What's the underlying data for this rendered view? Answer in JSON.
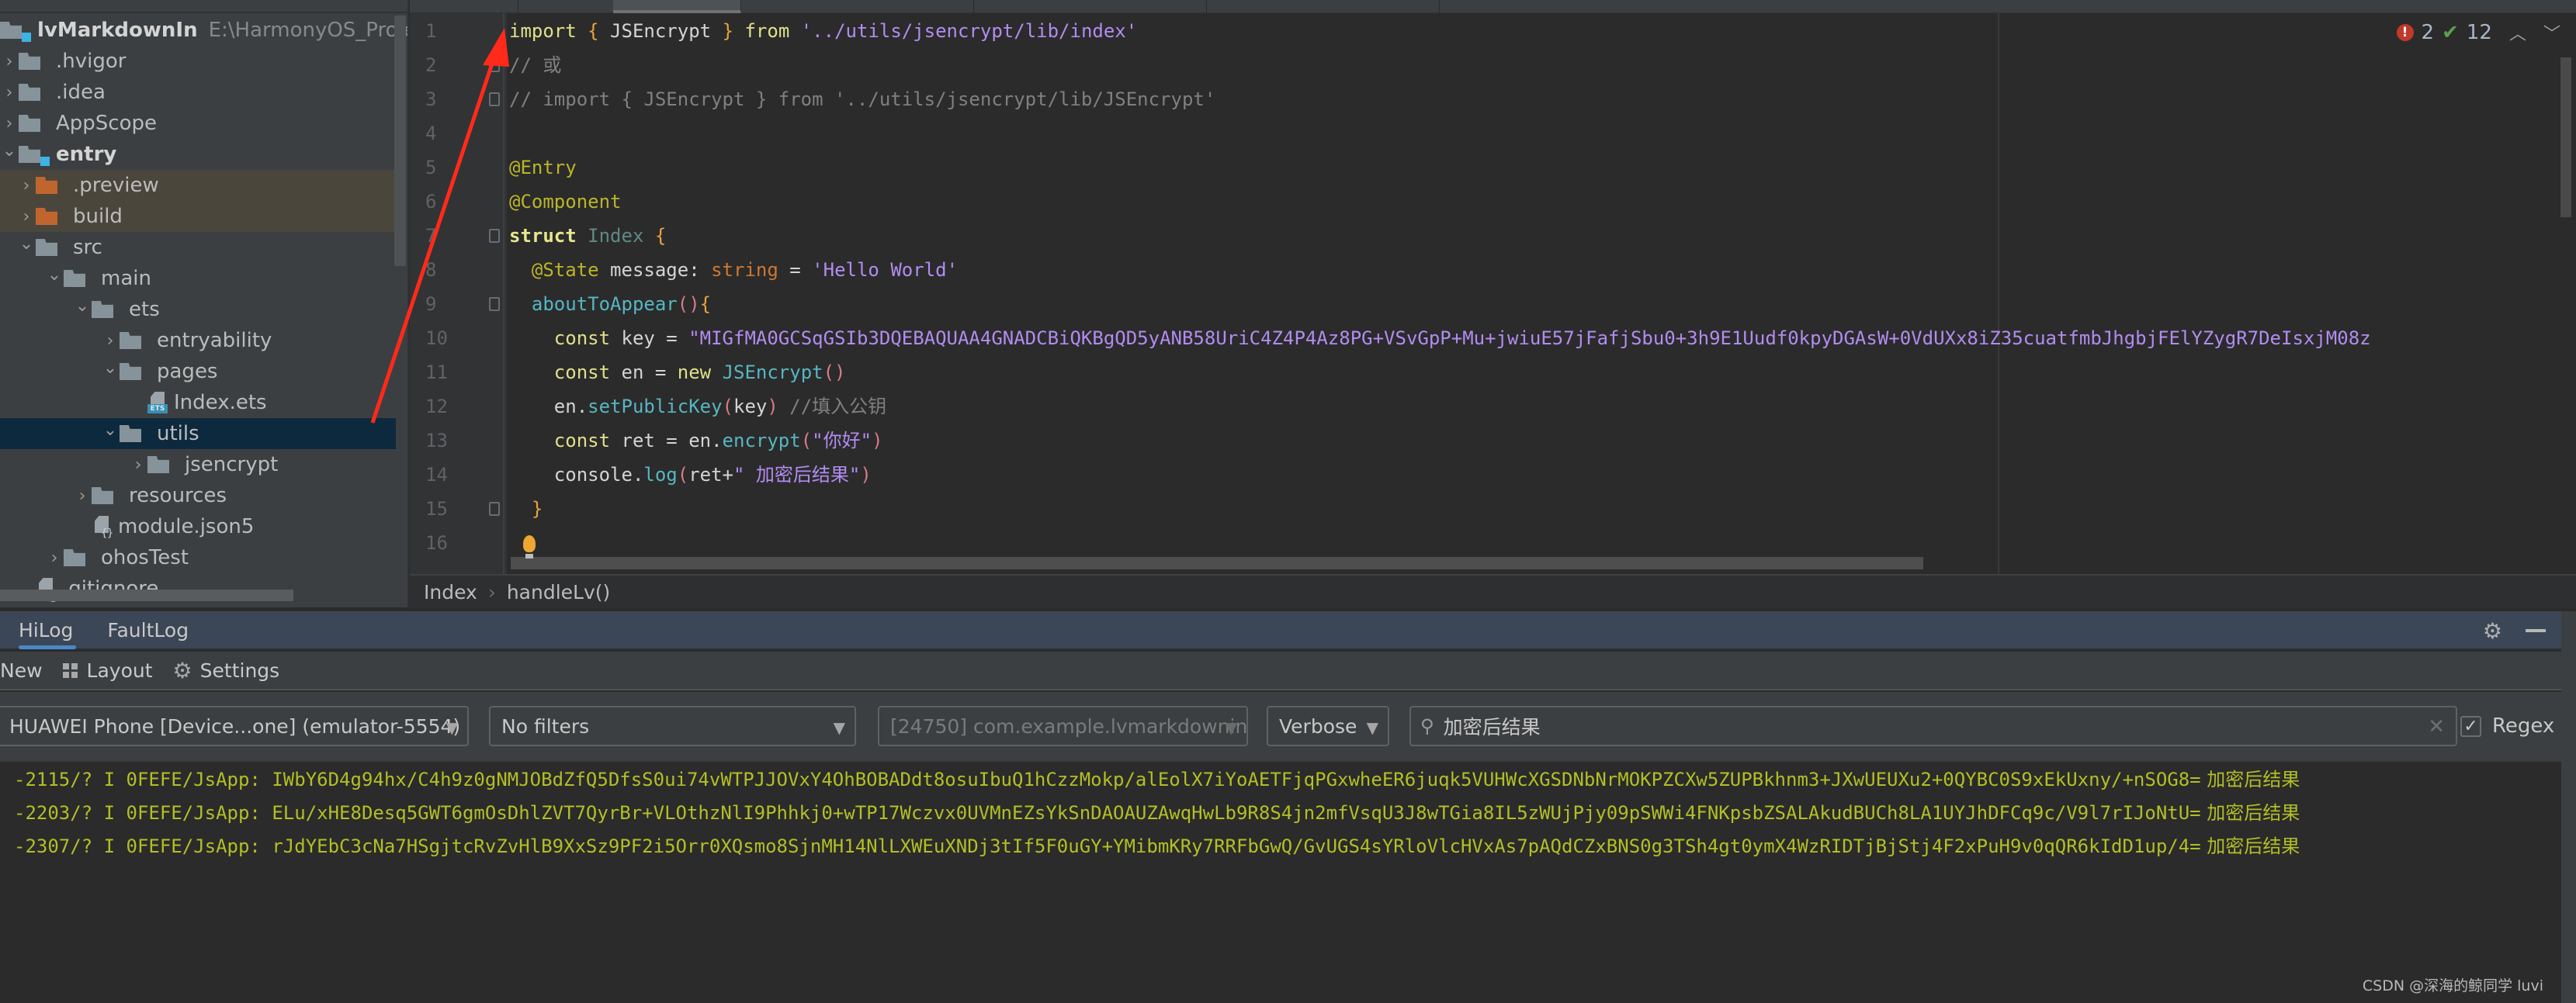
{
  "project": {
    "root_name": "lvMarkdownIn",
    "root_path": "E:\\HarmonyOS_Project\\lvM",
    "tree": [
      {
        "label": "lvMarkdownIn",
        "depth": 0,
        "type": "module-root",
        "expanded": true
      },
      {
        "label": ".hvigor",
        "depth": 1,
        "type": "folder",
        "expanded": false
      },
      {
        "label": ".idea",
        "depth": 1,
        "type": "folder",
        "expanded": false
      },
      {
        "label": "AppScope",
        "depth": 1,
        "type": "folder",
        "expanded": false
      },
      {
        "label": "entry",
        "depth": 1,
        "type": "module",
        "expanded": true
      },
      {
        "label": ".preview",
        "depth": 2,
        "type": "excluded-folder",
        "expanded": false
      },
      {
        "label": "build",
        "depth": 2,
        "type": "excluded-folder",
        "expanded": false
      },
      {
        "label": "src",
        "depth": 2,
        "type": "folder",
        "expanded": true
      },
      {
        "label": "main",
        "depth": 3,
        "type": "folder",
        "expanded": true
      },
      {
        "label": "ets",
        "depth": 4,
        "type": "folder",
        "expanded": true
      },
      {
        "label": "entryability",
        "depth": 5,
        "type": "folder",
        "expanded": false
      },
      {
        "label": "pages",
        "depth": 5,
        "type": "folder",
        "expanded": true
      },
      {
        "label": "Index.ets",
        "depth": 6,
        "type": "ets-file"
      },
      {
        "label": "utils",
        "depth": 5,
        "type": "folder",
        "expanded": true,
        "selected": true
      },
      {
        "label": "jsencrypt",
        "depth": 6,
        "type": "folder",
        "expanded": false
      },
      {
        "label": "resources",
        "depth": 4,
        "type": "folder",
        "expanded": false
      },
      {
        "label": "module.json5",
        "depth": 4,
        "type": "json-file"
      },
      {
        "label": "ohosTest",
        "depth": 3,
        "type": "folder",
        "expanded": false
      },
      {
        "label": ".gitignore",
        "depth": 2,
        "type": "ignore-file"
      }
    ],
    "ets_tag": "ETS",
    "json_tag": "{}"
  },
  "editor": {
    "inspections": {
      "errors": "2",
      "warnings": "12"
    },
    "lines": [
      {
        "n": "1",
        "tokens": [
          [
            "k",
            "import"
          ],
          [
            "plain",
            " "
          ],
          [
            "brace",
            "{"
          ],
          [
            "plain",
            " JSEncrypt "
          ],
          [
            "brace",
            "}"
          ],
          [
            "plain",
            " "
          ],
          [
            "k",
            "from"
          ],
          [
            "plain",
            " "
          ],
          [
            "str",
            "'../utils/jsencrypt/lib/index'"
          ]
        ]
      },
      {
        "n": "2",
        "tokens": [
          [
            "cmt",
            "// 或"
          ]
        ]
      },
      {
        "n": "3",
        "tokens": [
          [
            "cmt",
            "// import { JSEncrypt } from '../utils/jsencrypt/lib/JSEncrypt'"
          ]
        ]
      },
      {
        "n": "4",
        "tokens": []
      },
      {
        "n": "5",
        "tokens": [
          [
            "ann",
            "@Entry"
          ]
        ]
      },
      {
        "n": "6",
        "tokens": [
          [
            "ann",
            "@Component"
          ]
        ]
      },
      {
        "n": "7",
        "tokens": [
          [
            "kb",
            "struct"
          ],
          [
            "plain",
            " "
          ],
          [
            "cls",
            "Index"
          ],
          [
            "plain",
            " "
          ],
          [
            "brace",
            "{"
          ]
        ]
      },
      {
        "n": "8",
        "tokens": [
          [
            "plain",
            "  "
          ],
          [
            "ann",
            "@State"
          ],
          [
            "plain",
            " message: "
          ],
          [
            "typ",
            "string"
          ],
          [
            "plain",
            " = "
          ],
          [
            "str",
            "'Hello World'"
          ]
        ]
      },
      {
        "n": "9",
        "tokens": [
          [
            "plain",
            "  "
          ],
          [
            "fn",
            "aboutToAppear"
          ],
          [
            "paren",
            "()"
          ],
          [
            "brace",
            "{"
          ]
        ]
      },
      {
        "n": "10",
        "tokens": [
          [
            "plain",
            "    "
          ],
          [
            "k",
            "const"
          ],
          [
            "plain",
            " key = "
          ],
          [
            "str",
            "\"MIGfMA0GCSqGSIb3DQEBAQUAA4GNADCBiQKBgQD5yANB58UriC4Z4P4Az8PG+VSvGpP+Mu+jwiuE57jFafjSbu0+3h9E1Uudf0kpyDGAsW+0VdUXx8iZ35cuatfmbJhgbjFElYZygR7DeIsxjM08z"
          ]
        ]
      },
      {
        "n": "11",
        "tokens": [
          [
            "plain",
            "    "
          ],
          [
            "k",
            "const"
          ],
          [
            "plain",
            " en = "
          ],
          [
            "k",
            "new"
          ],
          [
            "plain",
            " "
          ],
          [
            "fn",
            "JSEncrypt"
          ],
          [
            "paren",
            "()"
          ]
        ]
      },
      {
        "n": "12",
        "tokens": [
          [
            "plain",
            "    en."
          ],
          [
            "fn",
            "setPublicKey"
          ],
          [
            "paren",
            "("
          ],
          [
            "plain",
            "key"
          ],
          [
            "paren",
            ")"
          ],
          [
            "plain",
            " "
          ],
          [
            "cmt",
            "//填入公钥"
          ]
        ]
      },
      {
        "n": "13",
        "tokens": [
          [
            "plain",
            "    "
          ],
          [
            "k",
            "const"
          ],
          [
            "plain",
            " ret = en."
          ],
          [
            "fn",
            "encrypt"
          ],
          [
            "paren",
            "("
          ],
          [
            "str",
            "\"你好\""
          ],
          [
            "paren",
            ")"
          ]
        ]
      },
      {
        "n": "14",
        "tokens": [
          [
            "plain",
            "    console."
          ],
          [
            "fn",
            "log"
          ],
          [
            "paren",
            "("
          ],
          [
            "plain",
            "ret+"
          ],
          [
            "str",
            "\" 加密后结果\""
          ],
          [
            "paren",
            ")"
          ]
        ]
      },
      {
        "n": "15",
        "tokens": [
          [
            "plain",
            "  "
          ],
          [
            "brace",
            "}"
          ]
        ]
      },
      {
        "n": "16",
        "tokens": []
      }
    ],
    "breadcrumb": [
      "Index",
      "handleLv()"
    ]
  },
  "log_window": {
    "tabs": [
      {
        "label": "HiLog",
        "active": true
      },
      {
        "label": "FaultLog",
        "active": false
      }
    ],
    "toolbar": {
      "new_label": "New",
      "layout_label": "Layout",
      "settings_label": "Settings"
    },
    "filters": {
      "device": "HUAWEI Phone [Device...one] (emulator-5554)",
      "filter": "No filters",
      "process": "[24750] com.example.lvmarkdownin",
      "level": "Verbose",
      "search": "加密后结果",
      "regex_label": "Regex",
      "regex_checked": true
    },
    "lines": [
      {
        "prefix": "-2115/? I 0FEFE/JsApp: ",
        "text": "IWbY6D4g94hx/C4h9z0gNMJOBdZfQ5DfsS0ui74vWTPJJOVxY4OhBOBADdt8osuIbuQ1hCzzMokp/alEolX7iYoAETFjqPGxwheER6juqk5VUHWcXGSDNbNrMOKPZCXw5ZUPBkhnm3+JXwUEUXu2+0QYBC0S9xEkUxny/+nSOG8=",
        "tail": " 加密后结果"
      },
      {
        "prefix": "-2203/? I 0FEFE/JsApp: ",
        "text": "ELu/xHE8Desq5GWT6gmOsDhlZVT7QyrBr+VLOthzNlI9Phhkj0+wTP17Wczvx0UVMnEZsYkSnDAOAUZAwqHwLb9R8S4jn2mfVsqU3J8wTGia8IL5zWUjPjy09pSWWi4FNKpsbZSALAkudBUCh8LA1UYJhDFCq9c/V9l7rIJoNtU=",
        "tail": " 加密后结果"
      },
      {
        "prefix": "-2307/? I 0FEFE/JsApp: ",
        "text": "rJdYEbC3cNa7HSgjtcRvZvHlB9XxSz9PF2i5Orr0XQsmo8SjnMH14NlLXWEuXNDj3tIf5F0uGY+YMibmKRy7RRFbGwQ/GvUGS4sYRloVlcHVxAs7pAQdCZxBNS0g3TSh4gt0ymX4WzRIDTjBjStj4F2xPuH9v0qQR6kIdD1up/4=",
        "tail": " 加密后结果"
      }
    ]
  },
  "watermark": "CSDN @深海的鲸同学 luvi",
  "colors": {
    "accent": "#4a88c7",
    "error": "#c0392b",
    "ok": "#59a14b",
    "log_text": "#b3bf24",
    "annotation_arrow": "#ff2a1a"
  }
}
